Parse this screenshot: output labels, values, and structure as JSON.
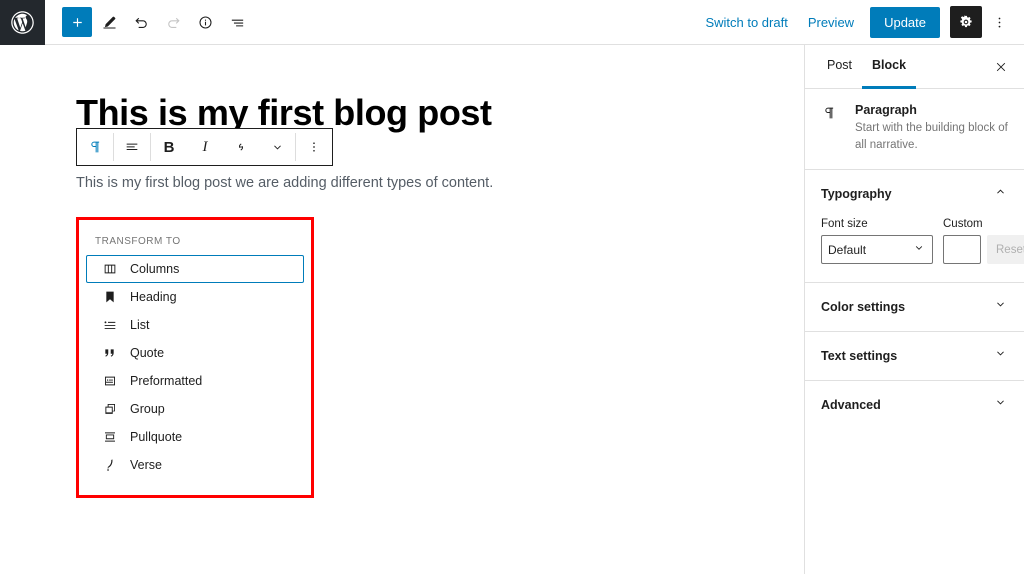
{
  "colors": {
    "accent": "#007cba",
    "admin_bar": "#23282d",
    "annotation": "#ff0000",
    "muted_text": "#757575"
  },
  "topbar": {
    "logo_icon": "wordpress-logo-icon",
    "left_tools": [
      {
        "name": "add-block-button",
        "icon": "plus-icon",
        "label": "Add block",
        "style": "primary"
      },
      {
        "name": "edit-mode-button",
        "icon": "pencil-icon",
        "label": "Tools",
        "style": "plain"
      },
      {
        "name": "undo-button",
        "icon": "undo-arrow-icon",
        "label": "Undo",
        "style": "plain"
      },
      {
        "name": "redo-button",
        "icon": "redo-arrow-icon",
        "label": "Redo",
        "style": "disabled"
      },
      {
        "name": "details-button",
        "icon": "info-circle-icon",
        "label": "Details",
        "style": "plain"
      },
      {
        "name": "list-view-button",
        "icon": "list-view-icon",
        "label": "List view",
        "style": "plain"
      }
    ],
    "switch_to_draft": "Switch to draft",
    "preview": "Preview",
    "update": "Update",
    "settings_icon": "gear-icon",
    "more_icon": "kebab-menu-icon"
  },
  "editor": {
    "title": "This is my first blog post",
    "paragraph": "This is my first blog post we are adding different types of content."
  },
  "block_toolbar": {
    "items": [
      {
        "name": "block-type-button",
        "icon": "paragraph-pilcrow-icon",
        "label": "Paragraph",
        "active": true
      },
      {
        "name": "align-button",
        "icon": "text-align-icon",
        "label": "Align"
      },
      {
        "name": "bold-button",
        "icon": "bold-icon",
        "label": "B"
      },
      {
        "name": "italic-button",
        "icon": "italic-icon",
        "label": "I"
      },
      {
        "name": "link-button",
        "icon": "link-icon",
        "label": "Link"
      },
      {
        "name": "more-rich-text-button",
        "icon": "chevron-down-icon",
        "label": "More"
      },
      {
        "name": "block-options-button",
        "icon": "kebab-menu-icon",
        "label": "Options"
      }
    ]
  },
  "transform_menu": {
    "label": "TRANSFORM TO",
    "items": [
      {
        "label": "Columns",
        "icon": "columns-icon",
        "selected": true
      },
      {
        "label": "Heading",
        "icon": "heading-bookmark-icon",
        "selected": false
      },
      {
        "label": "List",
        "icon": "list-icon",
        "selected": false
      },
      {
        "label": "Quote",
        "icon": "quote-marks-icon",
        "selected": false
      },
      {
        "label": "Preformatted",
        "icon": "preformatted-icon",
        "selected": false
      },
      {
        "label": "Group",
        "icon": "group-stack-icon",
        "selected": false
      },
      {
        "label": "Pullquote",
        "icon": "pullquote-icon",
        "selected": false
      },
      {
        "label": "Verse",
        "icon": "verse-quill-icon",
        "selected": false
      }
    ]
  },
  "sidebar": {
    "tabs": [
      {
        "label": "Post",
        "active": false
      },
      {
        "label": "Block",
        "active": true
      }
    ],
    "close_icon": "close-x-icon",
    "block_card": {
      "icon": "paragraph-pilcrow-icon",
      "title": "Paragraph",
      "description": "Start with the building block of all narrative."
    },
    "typography": {
      "title": "Typography",
      "expanded": true,
      "font_size_label": "Font size",
      "font_size_value": "Default",
      "custom_label": "Custom",
      "custom_value": "",
      "custom_placeholder": "",
      "reset_label": "Reset"
    },
    "panels": [
      {
        "title": "Color settings",
        "expanded": false
      },
      {
        "title": "Text settings",
        "expanded": false
      },
      {
        "title": "Advanced",
        "expanded": false
      }
    ]
  }
}
